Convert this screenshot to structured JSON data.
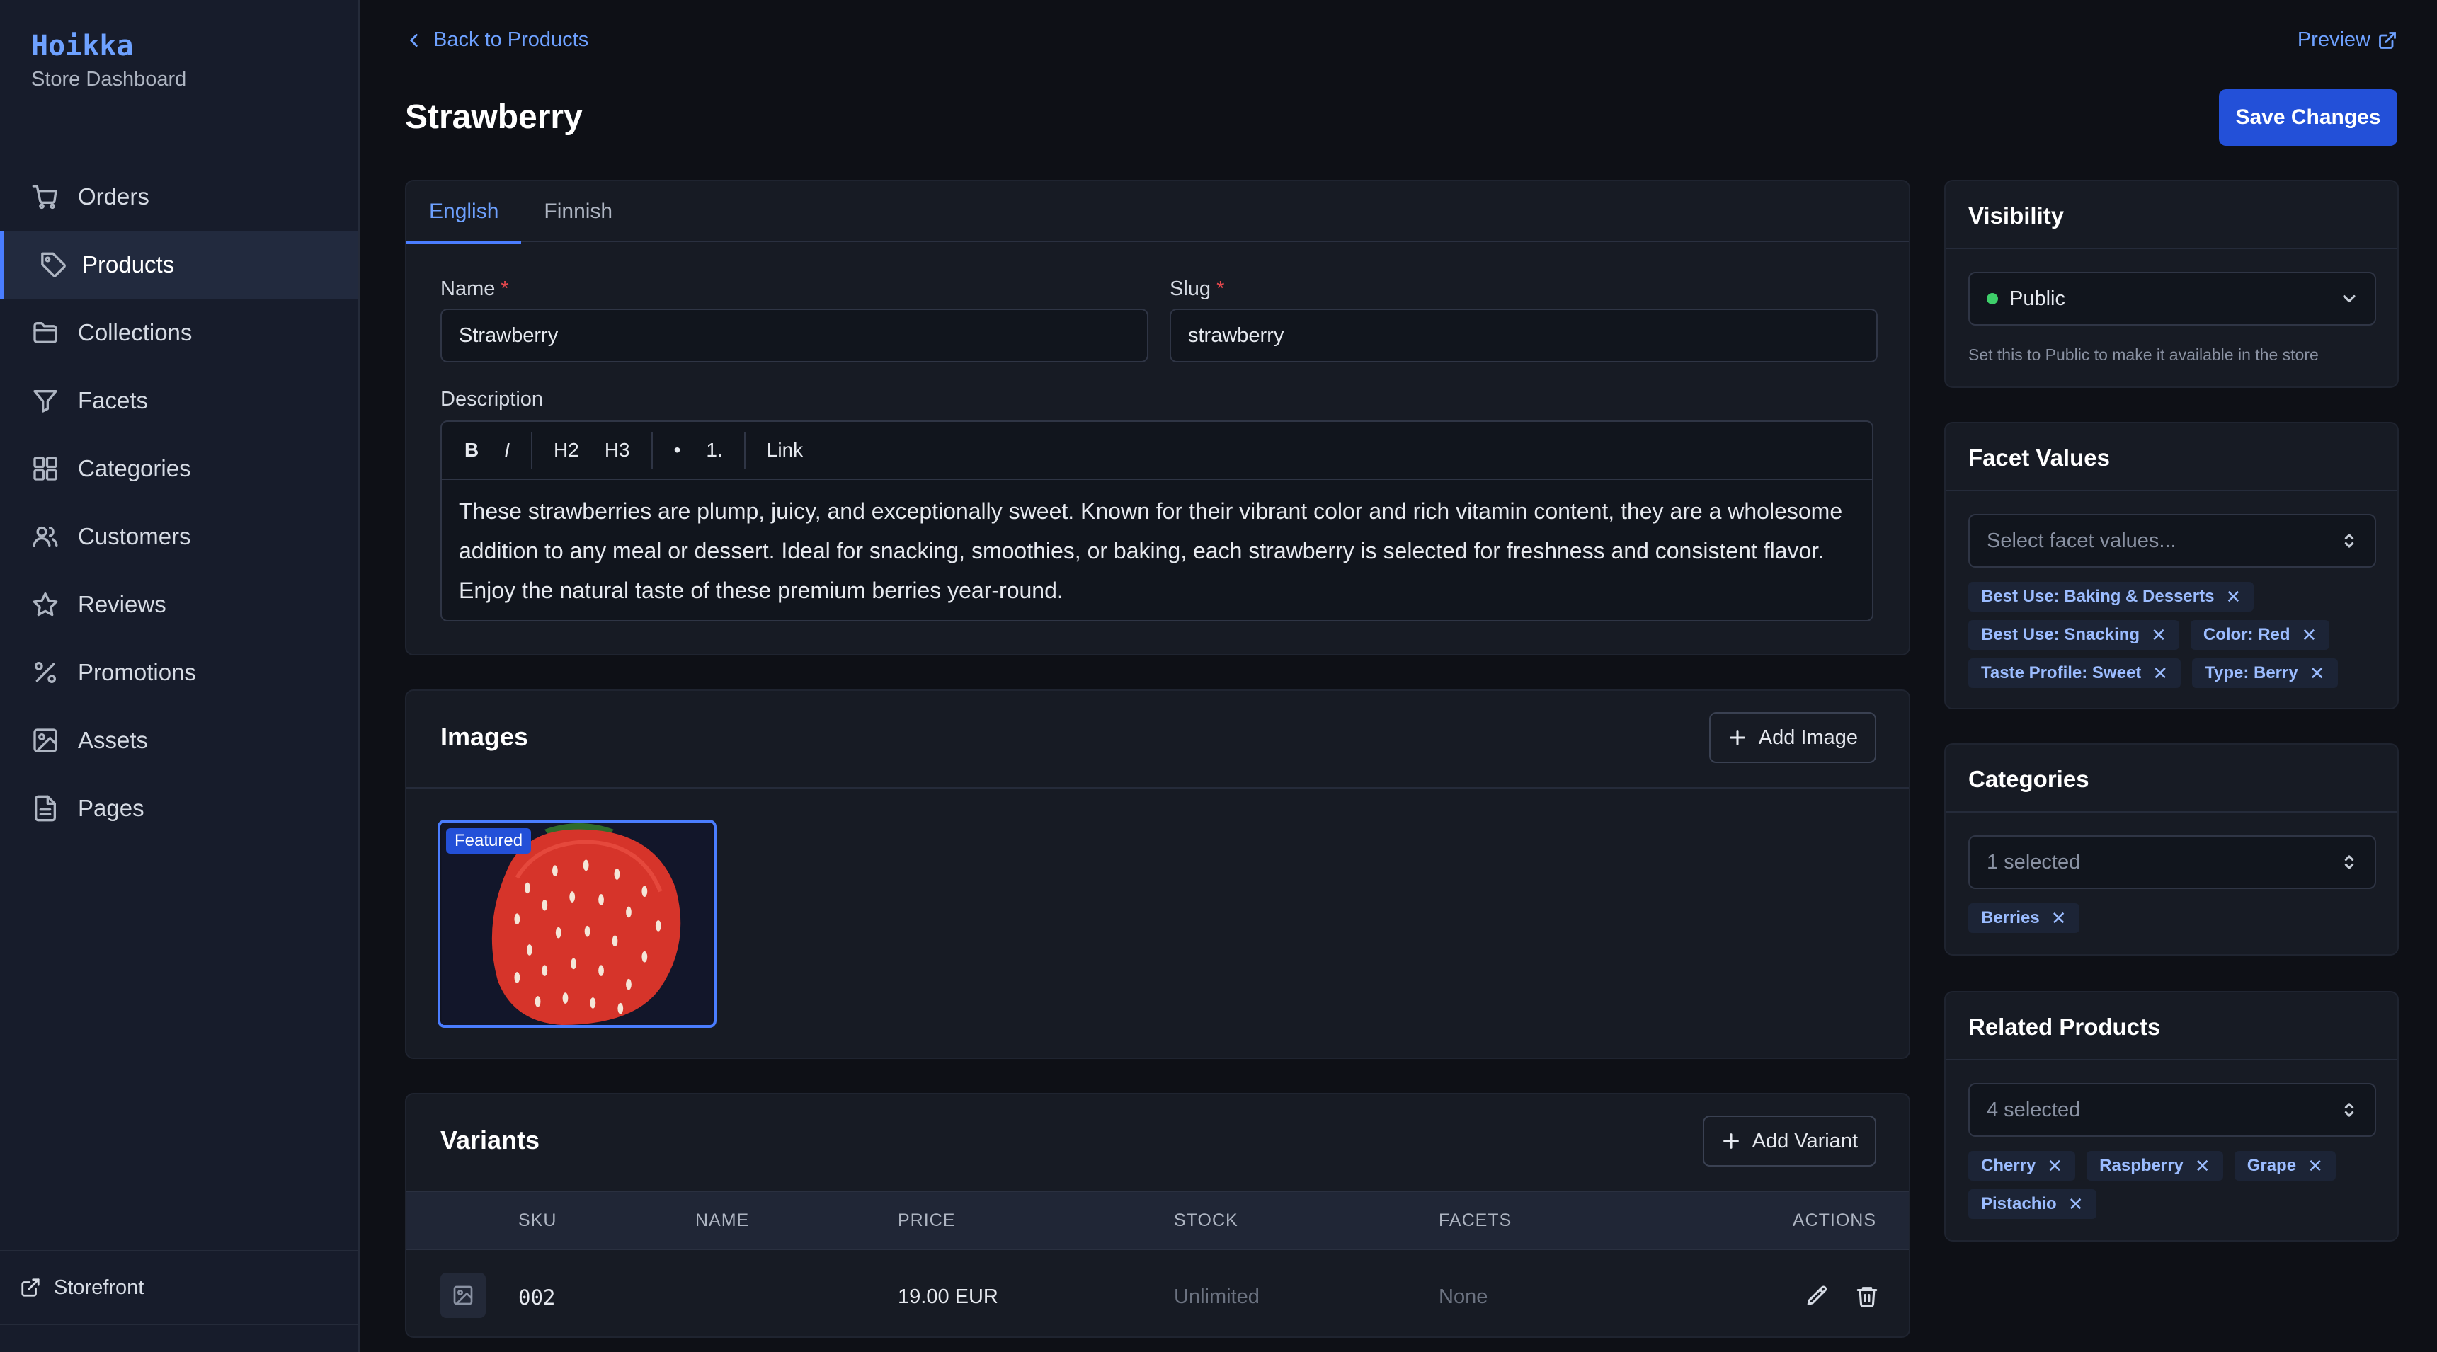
{
  "brand": {
    "name": "Hoikka",
    "subtitle": "Store Dashboard"
  },
  "nav": {
    "items": [
      {
        "label": "Orders",
        "icon": "cart-icon"
      },
      {
        "label": "Products",
        "icon": "tag-icon",
        "active": true
      },
      {
        "label": "Collections",
        "icon": "folder-icon"
      },
      {
        "label": "Facets",
        "icon": "filter-icon"
      },
      {
        "label": "Categories",
        "icon": "grid-icon"
      },
      {
        "label": "Customers",
        "icon": "users-icon"
      },
      {
        "label": "Reviews",
        "icon": "star-icon"
      },
      {
        "label": "Promotions",
        "icon": "percent-icon"
      },
      {
        "label": "Assets",
        "icon": "image-icon"
      },
      {
        "label": "Pages",
        "icon": "file-icon"
      }
    ],
    "footer_label": "Storefront"
  },
  "header": {
    "back_label": "Back to Products",
    "preview_label": "Preview",
    "title": "Strawberry",
    "save_label": "Save Changes"
  },
  "details": {
    "tabs": [
      "English",
      "Finnish"
    ],
    "active_tab": "English",
    "name_label": "Name",
    "name_value": "Strawberry",
    "slug_label": "Slug",
    "slug_value": "strawberry",
    "required_mark": "*",
    "description_label": "Description",
    "toolbar": [
      "B",
      "I",
      "H2",
      "H3",
      "•",
      "1.",
      "Link"
    ],
    "description": "These strawberries are plump, juicy, and exceptionally sweet. Known for their vibrant color and rich vitamin content, they are a wholesome addition to any meal or dessert. Ideal for snacking, smoothies, or baking, each strawberry is selected for freshness and consistent flavor. Enjoy the natural taste of these premium berries year-round."
  },
  "images": {
    "title": "Images",
    "add_label": "Add Image",
    "featured_label": "Featured"
  },
  "variants": {
    "title": "Variants",
    "add_label": "Add Variant",
    "columns": [
      "SKU",
      "NAME",
      "PRICE",
      "STOCK",
      "FACETS",
      "ACTIONS"
    ],
    "rows": [
      {
        "sku": "002",
        "name": "",
        "price": "19.00 EUR",
        "stock": "Unlimited",
        "facets": "None"
      }
    ]
  },
  "visibility": {
    "title": "Visibility",
    "value": "Public",
    "status_color": "#3ecf6a",
    "help": "Set this to Public to make it available in the store"
  },
  "facet_values": {
    "title": "Facet Values",
    "placeholder": "Select facet values...",
    "chips": [
      "Best Use: Baking & Desserts",
      "Best Use: Snacking",
      "Color: Red",
      "Taste Profile: Sweet",
      "Type: Berry"
    ]
  },
  "categories": {
    "title": "Categories",
    "selected": "1 selected",
    "chips": [
      "Berries"
    ]
  },
  "related_products": {
    "title": "Related Products",
    "selected": "4 selected",
    "chips": [
      "Cherry",
      "Raspberry",
      "Grape",
      "Pistachio"
    ]
  },
  "colors": {
    "accent": "#4a7dff",
    "primary_button": "#2350d8",
    "link": "#6ea1ff",
    "required": "#e5484d"
  }
}
